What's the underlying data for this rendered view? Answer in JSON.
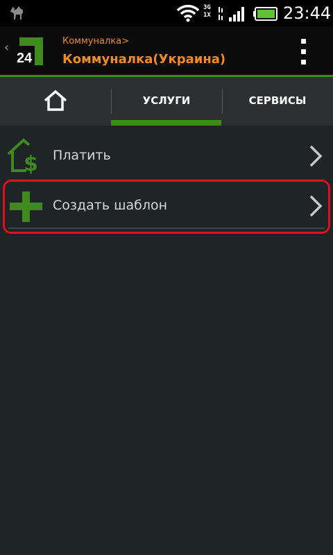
{
  "status_bar": {
    "network_top": "3G",
    "network_bottom": "1X",
    "time": "23:44",
    "icons": [
      "camel-icon",
      "wifi-icon",
      "network-activity-icon",
      "signal-icon",
      "battery-icon"
    ]
  },
  "header": {
    "logo_text": "24",
    "breadcrumb": "Коммуналка>",
    "title": "Коммуналка(Украина)",
    "back_icon": "‹",
    "accent_color": "#f28c1e",
    "brand_green": "#3f8a1c"
  },
  "tabs": {
    "items": [
      {
        "label": "",
        "icon": "home-icon",
        "selected": false
      },
      {
        "label": "УСЛУГИ",
        "selected": true
      },
      {
        "label": "СЕРВИСЫ",
        "selected": false
      }
    ]
  },
  "list": {
    "items": [
      {
        "label": "Платить",
        "icon": "house-dollar-icon"
      },
      {
        "label": "Создать шаблон",
        "icon": "plus-icon",
        "highlighted": true
      }
    ],
    "highlight_color": "#e0101a"
  }
}
